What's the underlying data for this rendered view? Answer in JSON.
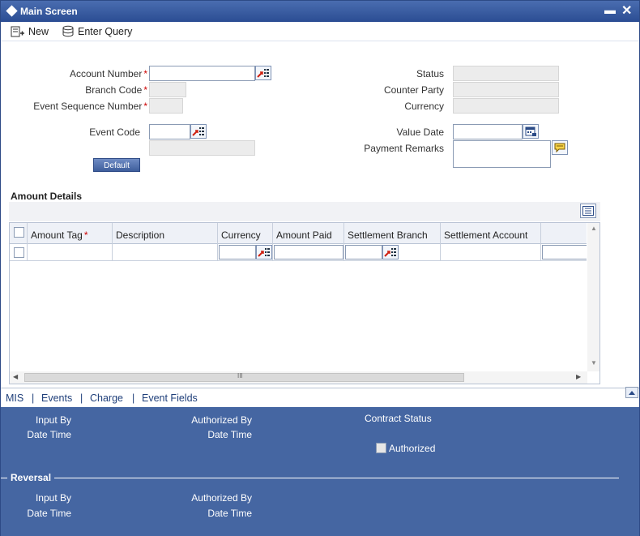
{
  "window": {
    "title": "Main Screen"
  },
  "toolbar": {
    "new_label": "New",
    "enter_query_label": "Enter Query"
  },
  "form": {
    "account_number_label": "Account Number",
    "branch_code_label": "Branch Code",
    "event_sequence_label": "Event Sequence Number",
    "event_code_label": "Event Code",
    "default_button_label": "Default",
    "status_label": "Status",
    "counter_party_label": "Counter Party",
    "currency_label": "Currency",
    "value_date_label": "Value Date",
    "payment_remarks_label": "Payment Remarks",
    "required_marker": "*"
  },
  "amount_details": {
    "title": "Amount Details",
    "columns": [
      "Amount Tag",
      "Description",
      "Currency",
      "Amount Paid",
      "Settlement Branch",
      "Settlement Account"
    ],
    "scroll_grip": "III"
  },
  "tabs": [
    "MIS",
    "Events",
    "Charge",
    "Event Fields"
  ],
  "tab_separator": "|",
  "footer": {
    "input_by": "Input By",
    "date_time": "Date Time",
    "authorized_by": "Authorized By",
    "contract_status": "Contract Status",
    "authorized": "Authorized",
    "reversal": "Reversal"
  },
  "icons": {
    "window": "diamond-icon",
    "new": "new-document-icon",
    "enter_query": "query-icon",
    "lov": "list-of-values-icon",
    "calendar": "calendar-icon",
    "remarks": "speech-bubble-icon",
    "grid_view": "grid-view-icon"
  },
  "colors": {
    "title_bar": "#2b4d93",
    "footer": "#4566a2",
    "required": "#cc0000"
  }
}
